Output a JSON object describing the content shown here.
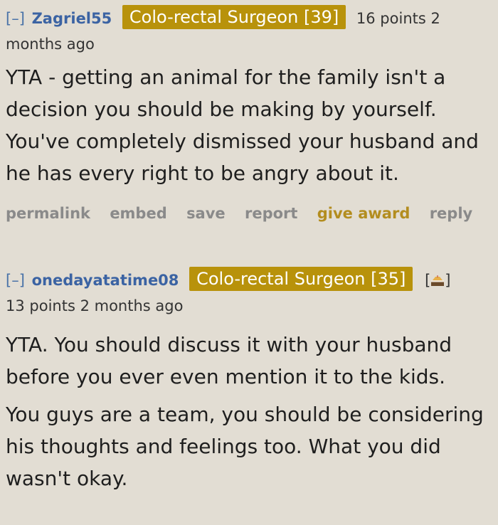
{
  "comments": [
    {
      "toggle": "[–]",
      "author": "Zagriel55",
      "flair": "Colo-rectal Surgeon [39]",
      "score": "16 points",
      "time": "2 months ago",
      "paragraphs": [
        "YTA - getting an animal for the family isn't a decision you should be making by yourself. You've completely dismissed your husband and he has every right to be angry about it."
      ],
      "buttons": {
        "permalink": "permalink",
        "embed": "embed",
        "save": "save",
        "report": "report",
        "give_award": "give award",
        "reply": "reply"
      }
    },
    {
      "toggle": "[–]",
      "author": "onedayatatime08",
      "flair": "Colo-rectal Surgeon [35]",
      "awards_open": "[",
      "awards_close": "]",
      "score": "13 points",
      "time": "2 months ago",
      "paragraphs": [
        "YTA. You should discuss it with your husband before you ever even mention it to the kids.",
        "You guys are a team, you should be considering his thoughts and feelings too. What you did wasn't okay."
      ]
    }
  ],
  "colors": {
    "background": "#e2ddd3",
    "author": "#3b63a3",
    "flair_bg": "#b8920b",
    "button_gray": "#8a8a8a",
    "award_gold": "#b38d1f"
  },
  "icons": {
    "award": "cake-icon"
  }
}
